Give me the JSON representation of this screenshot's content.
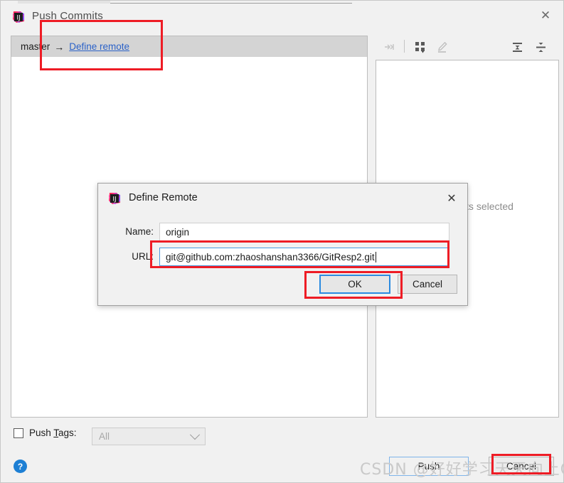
{
  "window": {
    "title": "Push Commits",
    "app_icon": "intellij-idea-icon",
    "close_icon": "close-icon"
  },
  "commits_panel": {
    "branch": "master",
    "arrow": "→",
    "define_remote_link": "Define remote"
  },
  "details_panel": {
    "empty_text": "No commits selected",
    "toolbar": [
      {
        "name": "collapse-selection-icon",
        "glyph": "→←",
        "enabled": false
      },
      {
        "name": "group-by-icon",
        "glyph": "grid",
        "enabled": true
      },
      {
        "name": "edit-icon",
        "glyph": "pencil",
        "enabled": false
      },
      {
        "name": "expand-all-icon",
        "glyph": "expand",
        "enabled": true
      },
      {
        "name": "collapse-all-icon",
        "glyph": "collapse",
        "enabled": true
      }
    ]
  },
  "footer": {
    "push_tags_checked": false,
    "push_tags_label_pre": "Push ",
    "push_tags_label_accel": "T",
    "push_tags_label_post": "ags:",
    "tags_combo_value": "All",
    "tags_combo_enabled": false,
    "help_label": "?",
    "push_button": "Push",
    "cancel_button": "Cancel"
  },
  "define_remote_dialog": {
    "title": "Define Remote",
    "app_icon": "intellij-idea-icon",
    "close_icon": "close-icon",
    "name_label": "Name:",
    "name_value": "origin",
    "url_label": "URL:",
    "url_value": "git@github.com:zhaoshanshan3366/GitResp2.git",
    "ok_button": "OK",
    "cancel_button": "Cancel"
  },
  "watermark": {
    "text": "CSDN @好好学习天天向上OAO"
  },
  "annotations": {
    "color": "#ee1c25",
    "boxes": [
      "define-remote-link-highlight",
      "url-field-highlight",
      "ok-button-highlight",
      "cancel-button-highlight"
    ]
  }
}
